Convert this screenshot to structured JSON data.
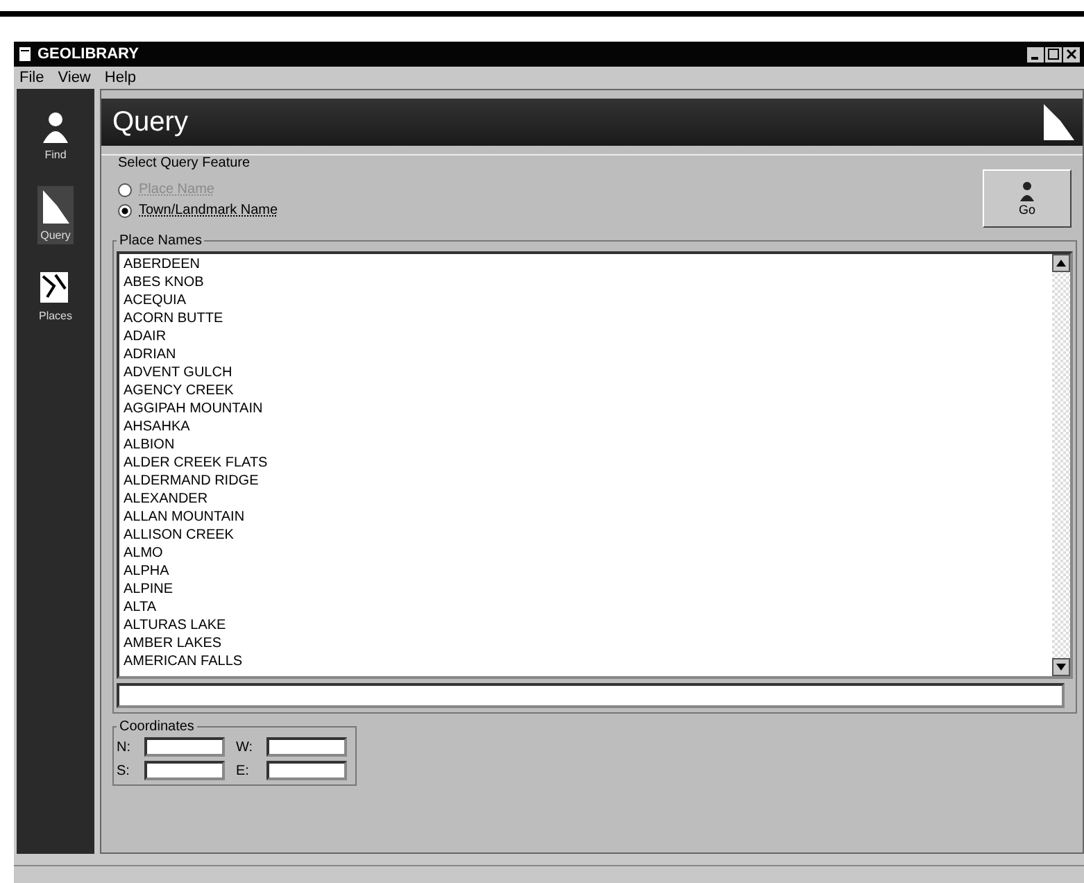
{
  "window": {
    "title": "GEOLIBRARY"
  },
  "menu": [
    "File",
    "View",
    "Help"
  ],
  "sidebar": {
    "items": [
      {
        "label": "Find",
        "selected": false
      },
      {
        "label": "Query",
        "selected": true
      },
      {
        "label": "Places",
        "selected": false
      }
    ]
  },
  "header": {
    "title": "Query"
  },
  "query_type": {
    "label": "Select Query Feature",
    "options": [
      {
        "label": "Place Name",
        "selected": false,
        "disabled": true
      },
      {
        "label": "Town/Landmark Name",
        "selected": true,
        "disabled": false
      }
    ]
  },
  "run_button": {
    "label": "Go"
  },
  "place_names": {
    "label": "Place Names",
    "items": [
      "ABERDEEN",
      "ABES KNOB",
      "ACEQUIA",
      "ACORN BUTTE",
      "ADAIR",
      "ADRIAN",
      "ADVENT GULCH",
      "AGENCY CREEK",
      "AGGIPAH MOUNTAIN",
      "AHSAHKA",
      "ALBION",
      "ALDER CREEK FLATS",
      "ALDERMAND RIDGE",
      "ALEXANDER",
      "ALLAN MOUNTAIN",
      "ALLISON CREEK",
      "ALMO",
      "ALPHA",
      "ALPINE",
      "ALTA",
      "ALTURAS LAKE",
      "AMBER LAKES",
      "AMERICAN FALLS"
    ]
  },
  "coordinates": {
    "label": "Coordinates",
    "fields": [
      {
        "label": "N:"
      },
      {
        "label": "W:"
      },
      {
        "label": "S:"
      },
      {
        "label": "E:"
      }
    ]
  }
}
